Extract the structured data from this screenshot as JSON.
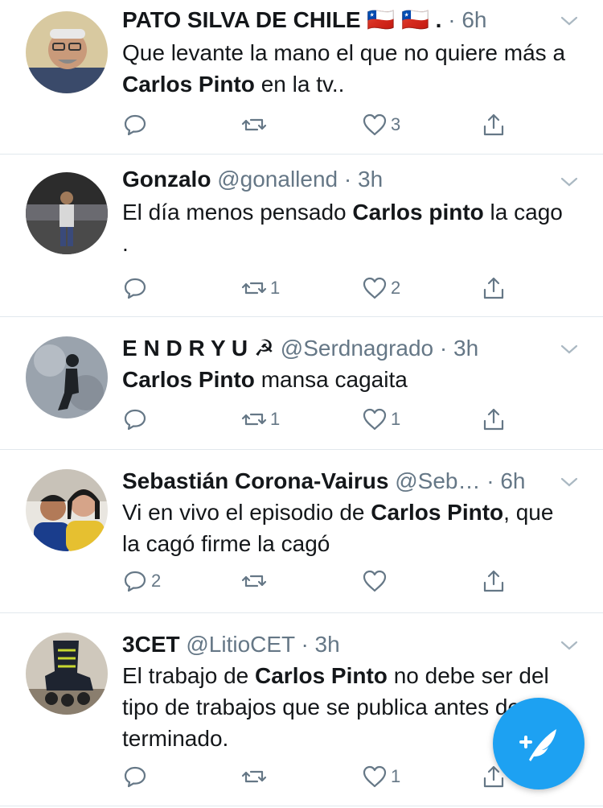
{
  "tweets": [
    {
      "name": "PATO SILVA DE CHILE 🇨🇱 🇨🇱 .",
      "handle": "",
      "separator": "·",
      "time": "6h",
      "text_before": "Que levante la mano el que no quiere más a ",
      "text_bold": "Carlos Pinto",
      "text_after": " en la tv..",
      "reply_count": "",
      "retweet_count": "",
      "like_count": "3"
    },
    {
      "name": "Gonzalo",
      "handle": "@gonallend",
      "separator": "·",
      "time": "3h",
      "text_before": "El día menos pensado ",
      "text_bold": "Carlos pinto",
      "text_after": " la cago .",
      "reply_count": "",
      "retweet_count": "1",
      "like_count": "2"
    },
    {
      "name": "E N D R Y U ☭",
      "handle": "@Serdnagrado",
      "separator": "·",
      "time": "3h",
      "text_before": "",
      "text_bold": "Carlos Pinto",
      "text_after": " mansa cagaita",
      "reply_count": "",
      "retweet_count": "1",
      "like_count": "1"
    },
    {
      "name": "Sebastián Corona-Vairus",
      "handle": "@Seb…",
      "separator": "·",
      "time": "6h",
      "text_before": "Vi en vivo el episodio de ",
      "text_bold": "Carlos Pinto",
      "text_after": ", que la cagó firme la cagó",
      "reply_count": "2",
      "retweet_count": "",
      "like_count": ""
    },
    {
      "name": "3CET",
      "handle": "@LitioCET",
      "separator": "·",
      "time": "3h",
      "text_before": "El trabajo de ",
      "text_bold": "Carlos Pinto",
      "text_after": " no debe ser del tipo de trabajos que se publica antes de ser terminado.",
      "reply_count": "",
      "retweet_count": "",
      "like_count": "1"
    }
  ],
  "icons": {
    "reply": "reply-icon",
    "retweet": "retweet-icon",
    "like": "heart-icon",
    "share": "share-icon",
    "menu": "chevron-down-icon",
    "compose": "compose-tweet-icon"
  },
  "colors": {
    "text": "#14171a",
    "secondary": "#657786",
    "divider": "#e1e8ed",
    "accent": "#1da1f2"
  }
}
